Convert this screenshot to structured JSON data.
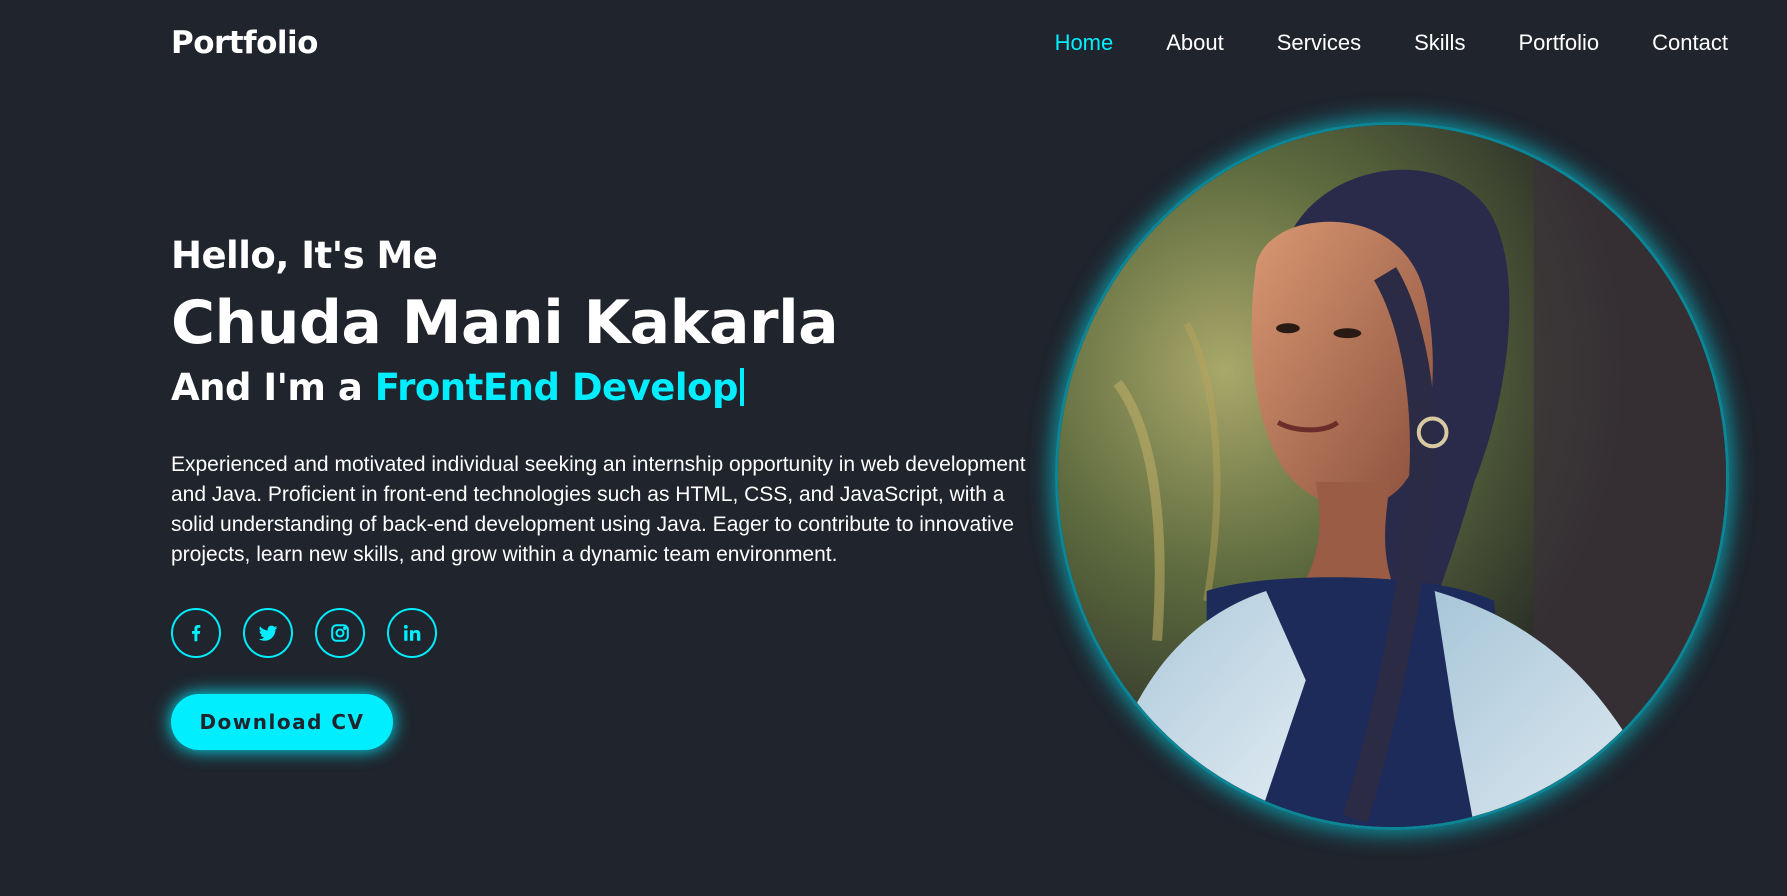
{
  "header": {
    "logo": "Portfolio",
    "nav": [
      "Home",
      "About",
      "Services",
      "Skills",
      "Portfolio",
      "Contact"
    ],
    "active": "Home"
  },
  "hero": {
    "greeting": "Hello, It's Me",
    "name": "Chuda Mani Kakarla",
    "role_prefix": "And I'm a ",
    "role_typed": "FrontEnd Develop",
    "bio": "Experienced and motivated individual seeking an internship opportunity in web development and Java. Proficient in front-end technologies such as HTML, CSS, and JavaScript, with a solid understanding of back-end development using Java. Eager to contribute to innovative projects, learn new skills, and grow within a dynamic team environment.",
    "socials": [
      "facebook-icon",
      "twitter-icon",
      "instagram-icon",
      "linkedin-icon"
    ],
    "cta": "Download CV"
  },
  "colors": {
    "background": "#1f242d",
    "accent": "#00eeff",
    "text": "#ffffff"
  }
}
